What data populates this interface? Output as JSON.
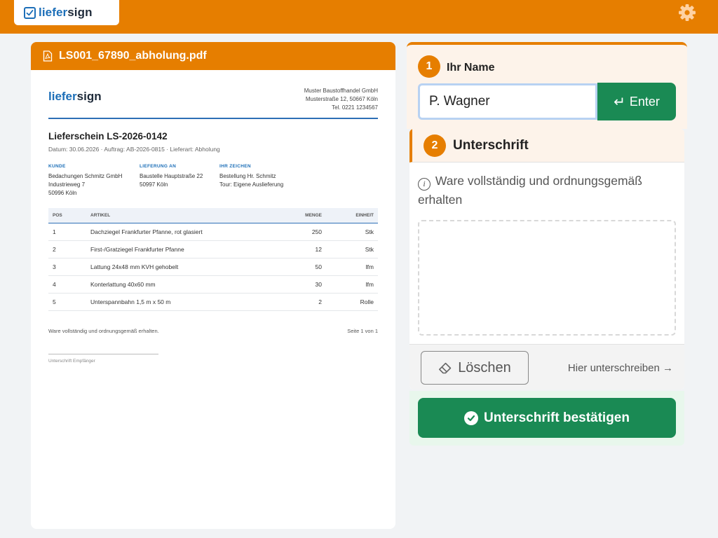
{
  "app": {
    "logo_part1": "liefer",
    "logo_part2": "sign"
  },
  "pdf": {
    "filename": "LS001_67890_abholung.pdf",
    "doc": {
      "logo_part1": "liefer",
      "logo_part2": "sign",
      "sender": [
        "Muster Baustoffhandel GmbH",
        "Musterstraße 12, 50667 Köln",
        "Tel. 0221 1234567"
      ],
      "title": "Lieferschein LS-2026-0142",
      "meta": "Datum: 30.06.2026  ·  Auftrag: AB-2026-0815  ·  Lieferart: Abholung",
      "customer": {
        "heading": "KUNDE",
        "lines": [
          "Bedachungen Schmitz GmbH",
          "Industrieweg 7",
          "50996 Köln"
        ]
      },
      "delivery": {
        "heading": "LIEFERUNG AN",
        "lines": [
          "Baustelle Hauptstraße 22",
          "50997 Köln"
        ]
      },
      "reference": {
        "heading": "IHR ZEICHEN",
        "lines": [
          "Bestellung Hr. Schmitz",
          "Tour: Eigene Auslieferung"
        ]
      },
      "table": {
        "headers": [
          "POS",
          "ARTIKEL",
          "MENGE",
          "EINHEIT"
        ],
        "rows": [
          [
            "1",
            "Dachziegel Frankfurter Pfanne, rot glasiert",
            "250",
            "Stk"
          ],
          [
            "2",
            "First-/Gratziegel Frankfurter Pfanne",
            "12",
            "Stk"
          ],
          [
            "3",
            "Lattung 24x48 mm KVH gehobelt",
            "50",
            "lfm"
          ],
          [
            "4",
            "Konterlattung 40x60 mm",
            "30",
            "lfm"
          ],
          [
            "5",
            "Unterspannbahn 1,5 m x 50 m",
            "2",
            "Rolle"
          ]
        ]
      },
      "footer_note": "Ware vollständig und ordnungsgemäß erhalten.",
      "page_info": "Seite 1 von 1",
      "signature_caption": "Unterschrift Empfänger"
    }
  },
  "name_step": {
    "number": "1",
    "label": "Ihr Name",
    "value": "P. Wagner",
    "enter_label": "Enter"
  },
  "signature_step": {
    "number": "2",
    "title": "Unterschrift",
    "hint": "Ware vollständig und ordnungsgemäß erhalten",
    "clear_label": "Löschen",
    "sign_here": "Hier unterschreiben →"
  },
  "confirm": {
    "label": "Unterschrift bestätigen"
  },
  "colors": {
    "accent": "#e67e00",
    "success": "#1a8a54",
    "brand_blue": "#1d6fb8"
  }
}
